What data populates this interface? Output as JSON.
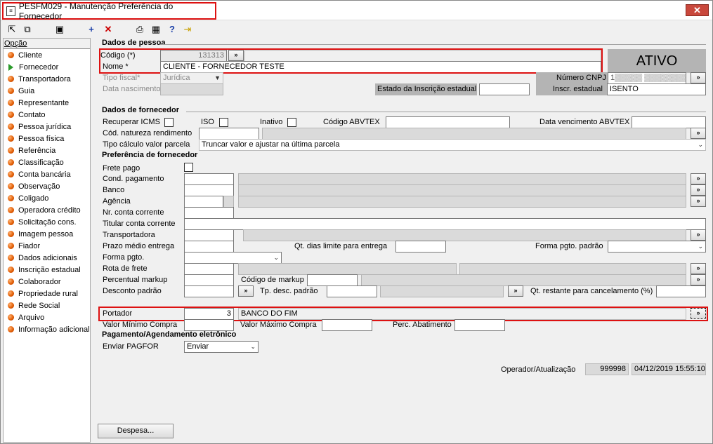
{
  "window": {
    "title": "PESFM029 - Manutenção Preferência do Fornecedor",
    "close": "✕"
  },
  "sidebar": {
    "header": "Opção",
    "items": [
      "Cliente",
      "Fornecedor",
      "Transportadora",
      "Guia",
      "Representante",
      "Contato",
      "Pessoa jurídica",
      "Pessoa física",
      "Referência",
      "Classificação",
      "Conta bancária",
      "Observação",
      "Coligado",
      "Operadora crédito",
      "Solicitação cons.",
      "Imagem pessoa",
      "Fiador",
      "Dados adicionais",
      "Inscrição estadual",
      "Colaborador",
      "Propriedade rural",
      "Rede Social",
      "Arquivo",
      "Informação adicional"
    ],
    "selected": "Fornecedor"
  },
  "pessoa": {
    "section": "Dados de pessoa",
    "codigo_label": "Código (*)",
    "codigo_value": "131313",
    "nome_label": "Nome *",
    "nome_value": "CLIENTE - FORNECEDOR TESTE",
    "tipo_fiscal_label": "Tipo fiscal*",
    "tipo_fiscal_value": "Jurídica",
    "data_nasc_label": "Data nascimento",
    "status": "ATIVO",
    "cnpj_label": "Número CNPJ",
    "cnpj_value": "1▒▒▒▒▒ ▒▒▒▒▒▒▒▒1",
    "estado_ie_label": "Estado da Inscrição estadual",
    "inscr_label": "Inscr. estadual",
    "inscr_value": "ISENTO"
  },
  "fornecedor": {
    "section": "Dados de fornecedor",
    "icms_label": "Recuperar ICMS",
    "iso_label": "ISO",
    "inativo_label": "Inativo",
    "abvtex_label": "Código ABVTEX",
    "data_venc_label": "Data vencimento ABVTEX",
    "natureza_label": "Cód. natureza rendimento",
    "tipo_calc_label": "Tipo cálculo valor parcela",
    "tipo_calc_value": "Truncar valor e ajustar na última parcela"
  },
  "preferencia": {
    "section": "Preferência de fornecedor",
    "frete_pago": "Frete pago",
    "cond_pag": "Cond. pagamento",
    "banco": "Banco",
    "agencia": "Agência",
    "nr_conta": "Nr. conta corrente",
    "titular": "Titular conta corrente",
    "transportadora": "Transportadora",
    "prazo": "Prazo médio entrega",
    "qt_dias": "Qt. dias limite para entrega",
    "forma_pgto_padrao": "Forma pgto. padrão",
    "forma_pgto": "Forma pgto.",
    "rota": "Rota de frete",
    "percentual": "Percentual markup",
    "cod_markup": "Código de markup",
    "desconto": "Desconto padrão",
    "tp_desc": "Tp. desc. padrão",
    "qt_restante": "Qt. restante para cancelamento (%)",
    "portador": "Portador",
    "portador_value": "3",
    "portador_nome": "BANCO DO FIM",
    "valor_min": "Valor Mínimo Compra",
    "valor_max": "Valor Máximo Compra",
    "perc_abat": "Perc. Abatimento"
  },
  "pagamento": {
    "section": "Pagamento/Agendamento eletrônico",
    "enviar_label": "Enviar PAGFOR",
    "enviar_value": "Enviar"
  },
  "footer": {
    "operador_label": "Operador/Atualização",
    "operador_value": "999998",
    "data_value": "04/12/2019 15:55:10",
    "despesa_button": "Despesa..."
  },
  "buttons": {
    "lookup": "»"
  }
}
